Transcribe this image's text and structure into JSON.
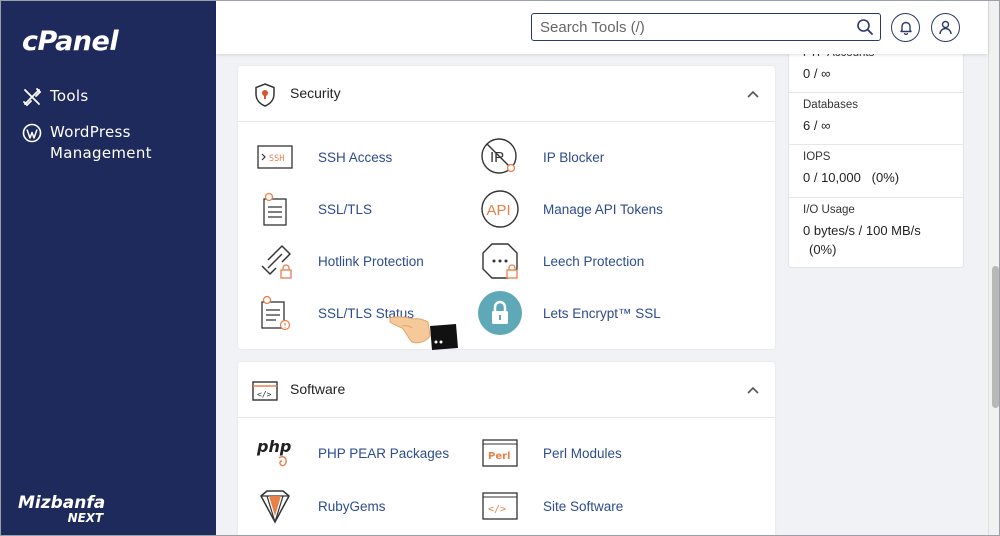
{
  "sidebar": {
    "logo": "cPanel",
    "items": [
      {
        "label": "Tools",
        "icon": "tools-icon"
      },
      {
        "label": "WordPress Management",
        "icon": "wordpress-icon"
      }
    ],
    "brand_line1": "Mizbanfa",
    "brand_line2": "NEXT"
  },
  "topbar": {
    "search_placeholder": "Search Tools (/)",
    "search_icon": "search-icon",
    "notification_icon": "bell-icon",
    "user_icon": "user-icon"
  },
  "security": {
    "title": "Security",
    "tools": [
      {
        "label": "SSH Access",
        "icon": "ssh-icon"
      },
      {
        "label": "IP Blocker",
        "icon": "ip-blocker-icon"
      },
      {
        "label": "SSL/TLS",
        "icon": "certificate-icon"
      },
      {
        "label": "Manage API Tokens",
        "icon": "api-icon"
      },
      {
        "label": "Hotlink Protection",
        "icon": "hotlink-icon"
      },
      {
        "label": "Leech Protection",
        "icon": "leech-icon"
      },
      {
        "label": "SSL/TLS Status",
        "icon": "ssl-status-icon"
      },
      {
        "label": "Lets Encrypt™ SSL",
        "icon": "lock-icon"
      }
    ]
  },
  "software": {
    "title": "Software",
    "tools": [
      {
        "label": "PHP PEAR Packages",
        "icon": "php-icon"
      },
      {
        "label": "Perl Modules",
        "icon": "perl-icon"
      },
      {
        "label": "RubyGems",
        "icon": "ruby-icon"
      },
      {
        "label": "Site Software",
        "icon": "site-software-icon"
      }
    ]
  },
  "stats": [
    {
      "label": "FTP Accounts",
      "value": "0 / ∞"
    },
    {
      "label": "Databases",
      "value": "6 / ∞"
    },
    {
      "label": "IOPS",
      "value": "0 / 10,000   (0%)"
    },
    {
      "label": "I/O Usage",
      "value": "0 bytes/s / 100 MB/s",
      "value2": "(0%)"
    }
  ],
  "colors": {
    "sidebar": "#1f2a5c",
    "link": "#2d4b8e",
    "accent": "#e8804a"
  }
}
